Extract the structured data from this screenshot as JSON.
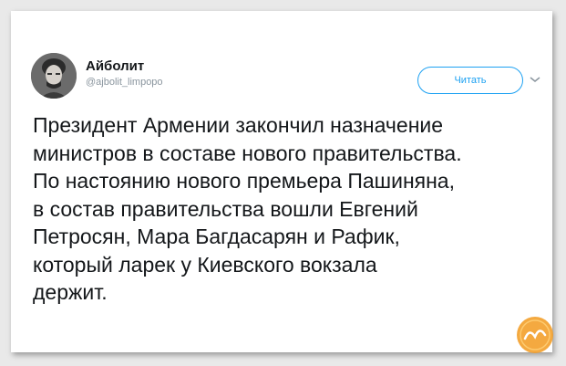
{
  "tweet": {
    "display_name": "Айболит",
    "handle": "@ajbolit_limpopo",
    "follow_label": "Читать",
    "text_lines": [
      "Президент Армении закончил назначение",
      "министров в составе нового правительства.",
      "По настоянию нового премьера Пашиняна,",
      "в состав правительства вошли Евгений",
      "Петросян, Мара Багдасарян и Рафик,",
      "который ларек у Киевского вокзала",
      "держит."
    ]
  },
  "colors": {
    "accent": "#1da1f2",
    "text": "#14171a",
    "muted": "#8a959e",
    "background": "#e9e9e9",
    "watermark": "#f29a1f"
  },
  "icons": {
    "more": "chevron-down-icon",
    "avatar": "avatar",
    "watermark": "logo-watermark"
  }
}
